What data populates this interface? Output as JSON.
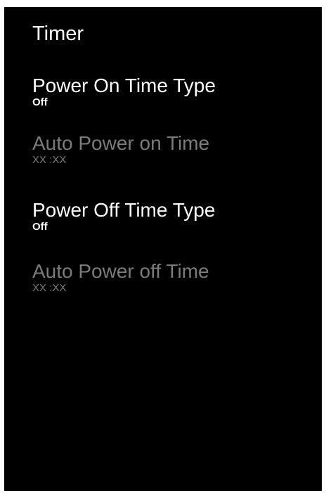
{
  "header": {
    "title": "Timer"
  },
  "menu": {
    "items": [
      {
        "label": "Power On Time Type",
        "value": "Off"
      },
      {
        "label": "Auto Power on Time",
        "value": "XX :XX"
      },
      {
        "label": "Power Off Time Type",
        "value": "Off"
      },
      {
        "label": "Auto Power off Time",
        "value": "XX :XX"
      }
    ]
  },
  "colors": {
    "background": "#000000",
    "text_enabled": "#ffffff",
    "text_disabled": "#7b7b7b"
  }
}
